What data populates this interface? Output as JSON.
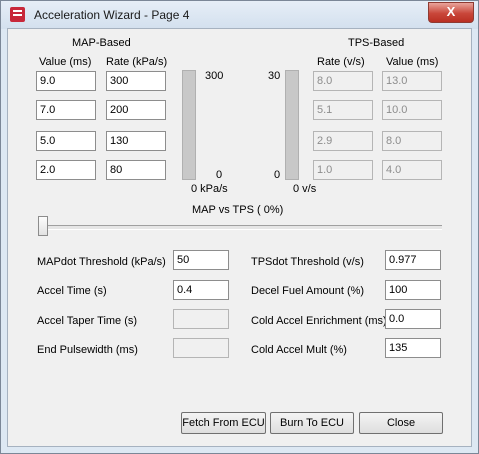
{
  "window": {
    "title": "Acceleration Wizard - Page 4",
    "close_glyph": "X"
  },
  "map": {
    "heading": "MAP-Based",
    "col_value": "Value (ms)",
    "col_rate": "Rate (kPa/s)",
    "values": [
      "9.0",
      "7.0",
      "5.0",
      "2.0"
    ],
    "rates": [
      "300",
      "200",
      "130",
      "80"
    ],
    "bar_max": "300",
    "bar_min": "0",
    "bar_unit": "0 kPa/s"
  },
  "tps": {
    "heading": "TPS-Based",
    "col_rate": "Rate (v/s)",
    "col_value": "Value (ms)",
    "rates": [
      "8.0",
      "5.1",
      "2.9",
      "1.0"
    ],
    "values": [
      "13.0",
      "10.0",
      "8.0",
      "4.0"
    ],
    "bar_max": "30",
    "bar_min": "0",
    "bar_unit": "0 v/s"
  },
  "blend": {
    "label": "MAP vs TPS (  0%)",
    "percent": 0
  },
  "params": {
    "mapdot_threshold": {
      "label": "MAPdot Threshold (kPa/s)",
      "value": "50"
    },
    "accel_time": {
      "label": "Accel Time (s)",
      "value": "0.4"
    },
    "accel_taper_time": {
      "label": "Accel Taper Time (s)",
      "value": ""
    },
    "end_pulsewidth": {
      "label": "End Pulsewidth (ms)",
      "value": ""
    },
    "tpsdot_threshold": {
      "label": "TPSdot Threshold (v/s)",
      "value": "0.977"
    },
    "decel_fuel_amount": {
      "label": "Decel Fuel Amount (%)",
      "value": "100"
    },
    "cold_accel_enrichment": {
      "label": "Cold Accel Enrichment (ms)",
      "value": "0.0"
    },
    "cold_accel_mult": {
      "label": "Cold Accel Mult (%)",
      "value": "135"
    }
  },
  "buttons": {
    "fetch": "Fetch From ECU",
    "burn": "Burn To ECU",
    "close": "Close"
  }
}
